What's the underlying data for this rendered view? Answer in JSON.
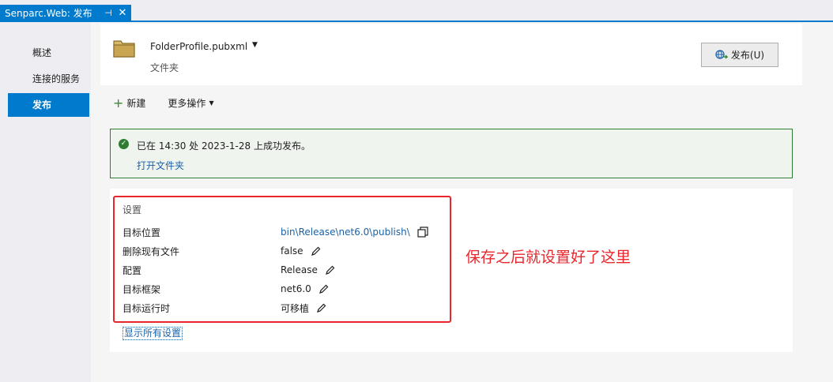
{
  "tab": {
    "title": "Senparc.Web: 发布",
    "pin_glyph": "⊣",
    "close_glyph": "✕"
  },
  "nav": {
    "items": [
      "概述",
      "连接的服务",
      "发布"
    ],
    "active_index": 2
  },
  "header": {
    "profile_name": "FolderProfile.pubxml",
    "profile_type": "文件夹",
    "publish_button": "发布(U)"
  },
  "actions": {
    "new_label": "新建",
    "more_label": "更多操作"
  },
  "status": {
    "message": "已在 14:30 处 2023-1-28 上成功发布。",
    "link": "打开文件夹",
    "color": "#2e7d32"
  },
  "settings": {
    "title": "设置",
    "rows": [
      {
        "label": "目标位置",
        "value": "bin\\Release\\net6.0\\publish\\"
      },
      {
        "label": "删除现有文件",
        "value": "false"
      },
      {
        "label": "配置",
        "value": "Release"
      },
      {
        "label": "目标框架",
        "value": "net6.0"
      },
      {
        "label": "目标运行时",
        "value": "可移植"
      }
    ],
    "show_all": "显示所有设置"
  },
  "annotation": {
    "text": "保存之后就设置好了这里",
    "color": "#e8262c"
  },
  "colors": {
    "accent": "#007acc",
    "link": "#1a62a8"
  }
}
